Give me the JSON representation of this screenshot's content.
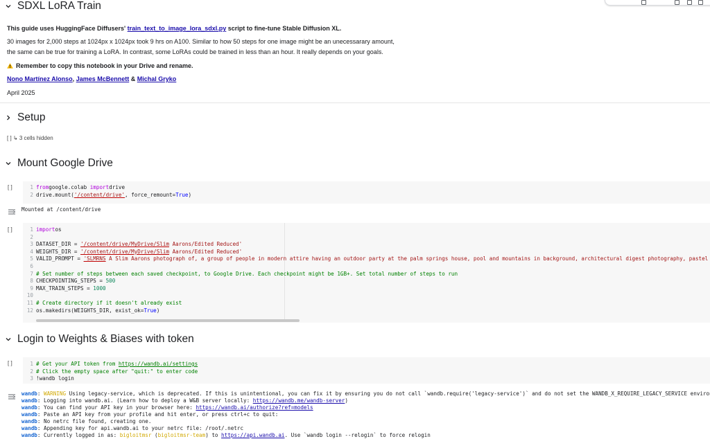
{
  "intro": {
    "title": "SDXL LoRA Train",
    "guide_prefix": "This guide uses HuggingFace Diffusers' ",
    "guide_link": "train_text_to_image_lora_sdxl.py",
    "guide_suffix": " script to fine-tune Stable Diffusion XL.",
    "para_line1": "30 images for 2,000 steps at 1024px x 1024px took 9 hrs on A100. Similar to how 50 steps for one image might be an unecessarary amount,",
    "para_line2": "the same can be true for training a LoRA. In contrast, some LoRAs could be trained in less than an hour. It really depends on your goals.",
    "remember": "Remember to copy this notebook in your Drive and rename.",
    "authors": [
      "Nono Martínez Alonso",
      "James McBennett",
      "Michal Gryko"
    ],
    "author_sep1": ", ",
    "author_sep2": " & ",
    "date": "April 2025"
  },
  "sections": {
    "setup": "Setup",
    "setup_hidden": "[ ] ↳ 3 cells hidden",
    "mount": "Mount Google Drive",
    "login": "Login to Weights & Biases with token"
  },
  "run_label": "[ ]",
  "cell1": {
    "lines": [
      [
        [
          "kw",
          "from"
        ],
        [
          "",
          "google.colab "
        ],
        [
          "kw",
          "import"
        ],
        [
          "",
          "drive"
        ]
      ],
      [
        [
          "",
          "drive.mount("
        ],
        [
          "ustr",
          "'/content/drive'"
        ],
        [
          "",
          ", force_remount="
        ],
        [
          "bool",
          "True"
        ],
        [
          "",
          ")"
        ]
      ]
    ],
    "output": "Mounted at /content/drive"
  },
  "cell2": {
    "lines": [
      [
        [
          "kw",
          "import"
        ],
        [
          "",
          "os"
        ]
      ],
      [],
      [
        [
          "",
          "DATASET_DIR = "
        ],
        [
          "ustr",
          "'/content/drive/MyDrive/Slim"
        ],
        [
          "str",
          " Aarons/Edited Reduced'"
        ]
      ],
      [
        [
          "",
          "WEIGHTS_DIR = "
        ],
        [
          "ustr",
          "'/content/drive/MyDrive/Slim"
        ],
        [
          "str",
          " Aarons/Edited Reduced'"
        ]
      ],
      [
        [
          "",
          "VALID_PROMPT = "
        ],
        [
          "ustr",
          "'SLMRNS"
        ],
        [
          "str",
          " A Slim Aarons photograph of, a group of people in modern attire having an outdoor party at the palm springs house, pool and mountains in background, architectural digest photography, pastel colo"
        ]
      ],
      [],
      [
        [
          "cm",
          "# Set number of steps between each saved checkpoint, to Google Drive. Each checkpoint might be 1GB+. Set total number of steps to run"
        ]
      ],
      [
        [
          "",
          "CHECKPOINTING_STEPS = "
        ],
        [
          "num",
          "500"
        ]
      ],
      [
        [
          "",
          "MAX_TRAIN_STEPS = "
        ],
        [
          "num",
          "1000"
        ]
      ],
      [],
      [
        [
          "cm",
          "# Create directory if it doesn't already exist"
        ]
      ],
      [
        [
          "",
          "os.makedirs(WEIGHTS_DIR, exist_ok="
        ],
        [
          "bool",
          "True"
        ],
        [
          "",
          ")"
        ]
      ]
    ]
  },
  "cell3": {
    "lines": [
      [
        [
          "cm",
          "# Get your API token from "
        ],
        [
          "cmlink",
          "https://wandb.ai/settings"
        ]
      ],
      [
        [
          "cm",
          "# Click the empty space after \"quit:\" to enter code"
        ]
      ],
      [
        [
          "",
          "!wandb login"
        ]
      ]
    ],
    "output": [
      [
        [
          "wb",
          "wandb"
        ],
        [
          "",
          ": "
        ],
        [
          "wbwarn",
          "WARNING"
        ],
        [
          "",
          " Using legacy-service, which is deprecated. If this is unintentional, you can fix it by ensuring you do not call `wandb.require('legacy-service')` and do not set the WANDB_X_REQUIRE_LEGACY_SERVICE environment"
        ]
      ],
      [
        [
          "wb",
          "wandb"
        ],
        [
          "",
          ": Logging into wandb.ai. (Learn how to deploy a W&B server locally: "
        ],
        [
          "olink",
          "https://wandb.me/wandb-server"
        ],
        [
          "",
          ")"
        ]
      ],
      [
        [
          "wb",
          "wandb"
        ],
        [
          "",
          ": You can find your API key in your browser here: "
        ],
        [
          "olink",
          "https://wandb.ai/authorize?ref=models"
        ]
      ],
      [
        [
          "wb",
          "wandb"
        ],
        [
          "",
          ": Paste an API key from your profile and hit enter, or press ctrl+c to quit:"
        ]
      ],
      [
        [
          "wb",
          "wandb"
        ],
        [
          "",
          ": No netrc file found, creating one."
        ]
      ],
      [
        [
          "wb",
          "wandb"
        ],
        [
          "",
          ": Appending key for api.wandb.ai to your netrc file: /root/.netrc"
        ]
      ],
      [
        [
          "wb",
          "wandb"
        ],
        [
          "",
          ": Currently logged in as: "
        ],
        [
          "wbwarn",
          "bigloitmsr"
        ],
        [
          "",
          " ("
        ],
        [
          "wbwarn",
          "bigloitmsr-team"
        ],
        [
          "",
          ") to "
        ],
        [
          "olink",
          "https://api.wandb.ai"
        ],
        [
          "",
          ". Use `wandb login --relogin` to force relogin"
        ]
      ]
    ]
  }
}
